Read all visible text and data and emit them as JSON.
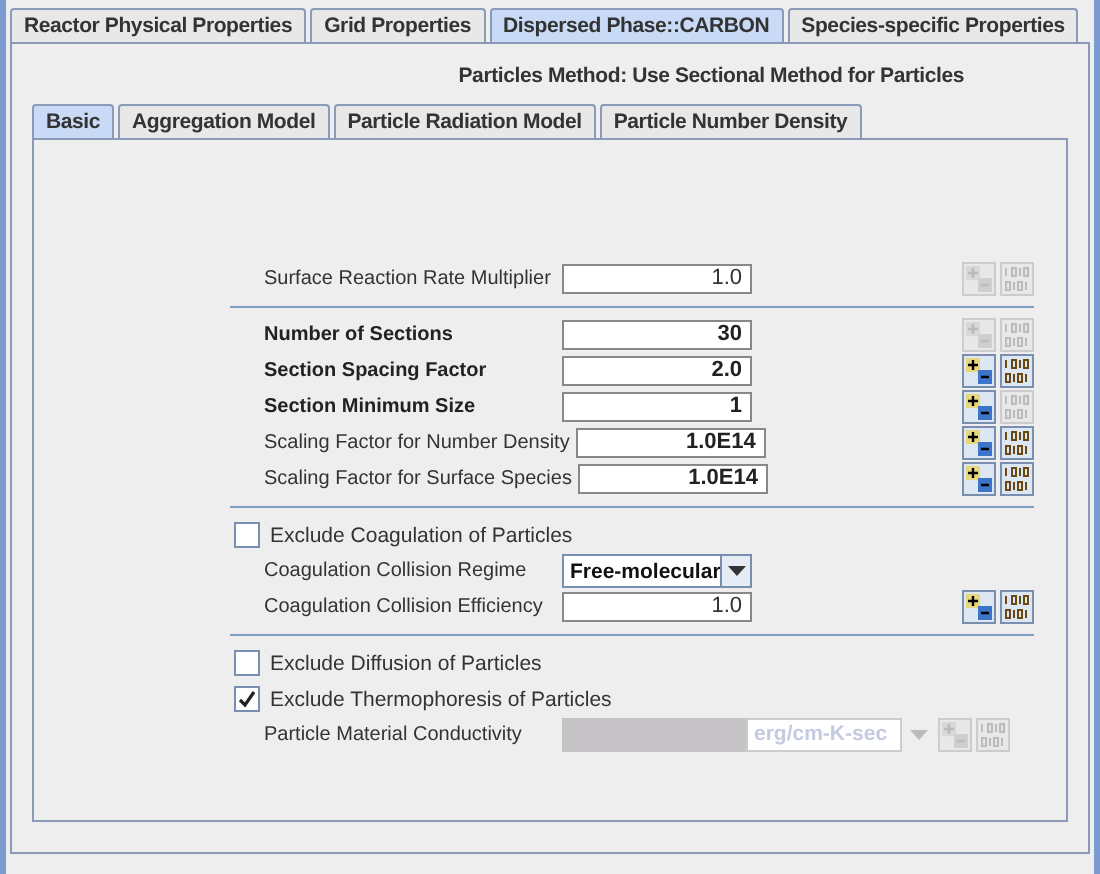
{
  "main_tabs": [
    {
      "label": "Reactor Physical Properties",
      "selected": false
    },
    {
      "label": "Grid Properties",
      "selected": false
    },
    {
      "label": "Dispersed Phase::CARBON",
      "selected": true
    },
    {
      "label": "Species-specific Properties",
      "selected": false
    }
  ],
  "heading": "Particles Method: Use Sectional Method for Particles",
  "sub_tabs": [
    {
      "label": "Basic",
      "selected": true
    },
    {
      "label": "Aggregation Model",
      "selected": false
    },
    {
      "label": "Particle Radiation Model",
      "selected": false
    },
    {
      "label": "Particle Number Density",
      "selected": false
    }
  ],
  "sections": [
    {
      "rows": [
        {
          "kind": "field",
          "label": "Surface Reaction Rate Multiplier",
          "bold": false,
          "value": "1.0",
          "value_bold": false,
          "step_enabled": false,
          "table_enabled": false
        }
      ]
    },
    {
      "rows": [
        {
          "kind": "field",
          "label": "Number of Sections",
          "bold": true,
          "value": "30",
          "value_bold": true,
          "step_enabled": false,
          "table_enabled": false
        },
        {
          "kind": "field",
          "label": "Section Spacing Factor",
          "bold": true,
          "value": "2.0",
          "value_bold": true,
          "step_enabled": true,
          "table_enabled": true
        },
        {
          "kind": "field",
          "label": "Section Minimum Size",
          "bold": true,
          "value": "1",
          "value_bold": true,
          "step_enabled": true,
          "table_enabled": false
        },
        {
          "kind": "field",
          "label": "Scaling Factor for Number Density",
          "bold": false,
          "value": "1.0E14",
          "value_bold": true,
          "step_enabled": true,
          "table_enabled": true
        },
        {
          "kind": "field",
          "label": "Scaling Factor for Surface Species",
          "bold": false,
          "value": "1.0E14",
          "value_bold": true,
          "step_enabled": true,
          "table_enabled": true
        }
      ]
    },
    {
      "rows": [
        {
          "kind": "checkbox",
          "label": "Exclude Coagulation of Particles",
          "checked": false
        },
        {
          "kind": "dropdown",
          "label": "Coagulation Collision Regime",
          "value": "Free-molecular"
        },
        {
          "kind": "field",
          "label": "Coagulation Collision Efficiency",
          "bold": false,
          "value": "1.0",
          "value_bold": false,
          "step_enabled": true,
          "table_enabled": true
        }
      ]
    },
    {
      "rows": [
        {
          "kind": "checkbox",
          "label": "Exclude Diffusion of Particles",
          "checked": false
        },
        {
          "kind": "checkbox",
          "label": "Exclude Thermophoresis of Particles",
          "checked": true
        },
        {
          "kind": "unit-field",
          "label": "Particle Material Conductivity",
          "unit": "erg/cm-K-sec",
          "disabled": true,
          "step_enabled": false,
          "table_enabled": false
        }
      ]
    }
  ]
}
